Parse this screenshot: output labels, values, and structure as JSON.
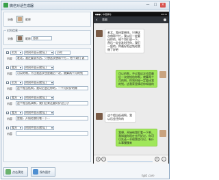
{
  "window": {
    "title": "微信对话生成器",
    "controls": [
      "—",
      "□",
      "×"
    ]
  },
  "sender_group": {
    "label_avatar": "头像",
    "label_nickname": "昵称"
  },
  "receiver_group": {
    "legend": "对方信息",
    "label_avatar": "头像",
    "label_nickname": "昵称",
    "nickname_value": "悲剧"
  },
  "rows": [
    {
      "check": "✓",
      "select": "对方",
      "label": "时间不显示(默认)",
      "extra": "小时"
    },
    {
      "prefix": "内容",
      "text": "老北，我还要说东西，只想这次想帮个忙... 给个哥们 说"
    },
    {
      "check": "✓",
      "select": "我方",
      "label": "时间不显示(默认)"
    },
    {
      "prefix": "内容",
      "text": "可以的啊，不过我这次也是最后一次，就算两个月的钱"
    },
    {
      "check": "✓",
      "select": "对方",
      "label": "时间不显示(默认)"
    },
    {
      "prefix": "内容",
      "text": "这个相当低啊，我以后会还你的，一个月好好的做"
    },
    {
      "check": "✓",
      "select": "我方",
      "label": "时间不显示(默认)"
    },
    {
      "prefix": "内容",
      "text": "这个相当低调啊，我们后来还要好好过日子"
    },
    {
      "check": "✓",
      "select": "我方",
      "label": "时间不显示(默认)"
    },
    {
      "prefix": "内容",
      "text": "是跟，开始给我们看一下..."
    },
    {
      "check": "",
      "select": "我方",
      "label": "时间不显示(默认)"
    },
    {
      "prefix": "内容",
      "text": ""
    }
  ],
  "buttons": {
    "preview": "点击预览",
    "save": "保存图片"
  },
  "watermark": "hjp1.com",
  "phone": {
    "status_left": "●●●○ 中国移动",
    "status_right": "08:15",
    "nav_back": "‹",
    "nav_title": "悲剧",
    "messages": [
      {
        "side": "in",
        "text": "老北，我还要借钱，只想这次借帮个忙，我以后一定要还你的，给个哥们说一下，然后一定会准时还你，我们一起的，你最好把这钱给我借了好吧"
      },
      {
        "side": "out",
        "text": "可以的啊，不过我这次也是最后一次借钱给你啊，就算两个月的吧，你到时候一定要还我的钱，这我家里情况你知道的"
      },
      {
        "side": "in",
        "text": "这个相当低调啊，我以后会还你的"
      },
      {
        "side": "out",
        "text": "我想，开始给我们看一下吧，我知道你现在也不好过，你可以先还一半给我也可以，有什么事慢慢来"
      }
    ]
  }
}
